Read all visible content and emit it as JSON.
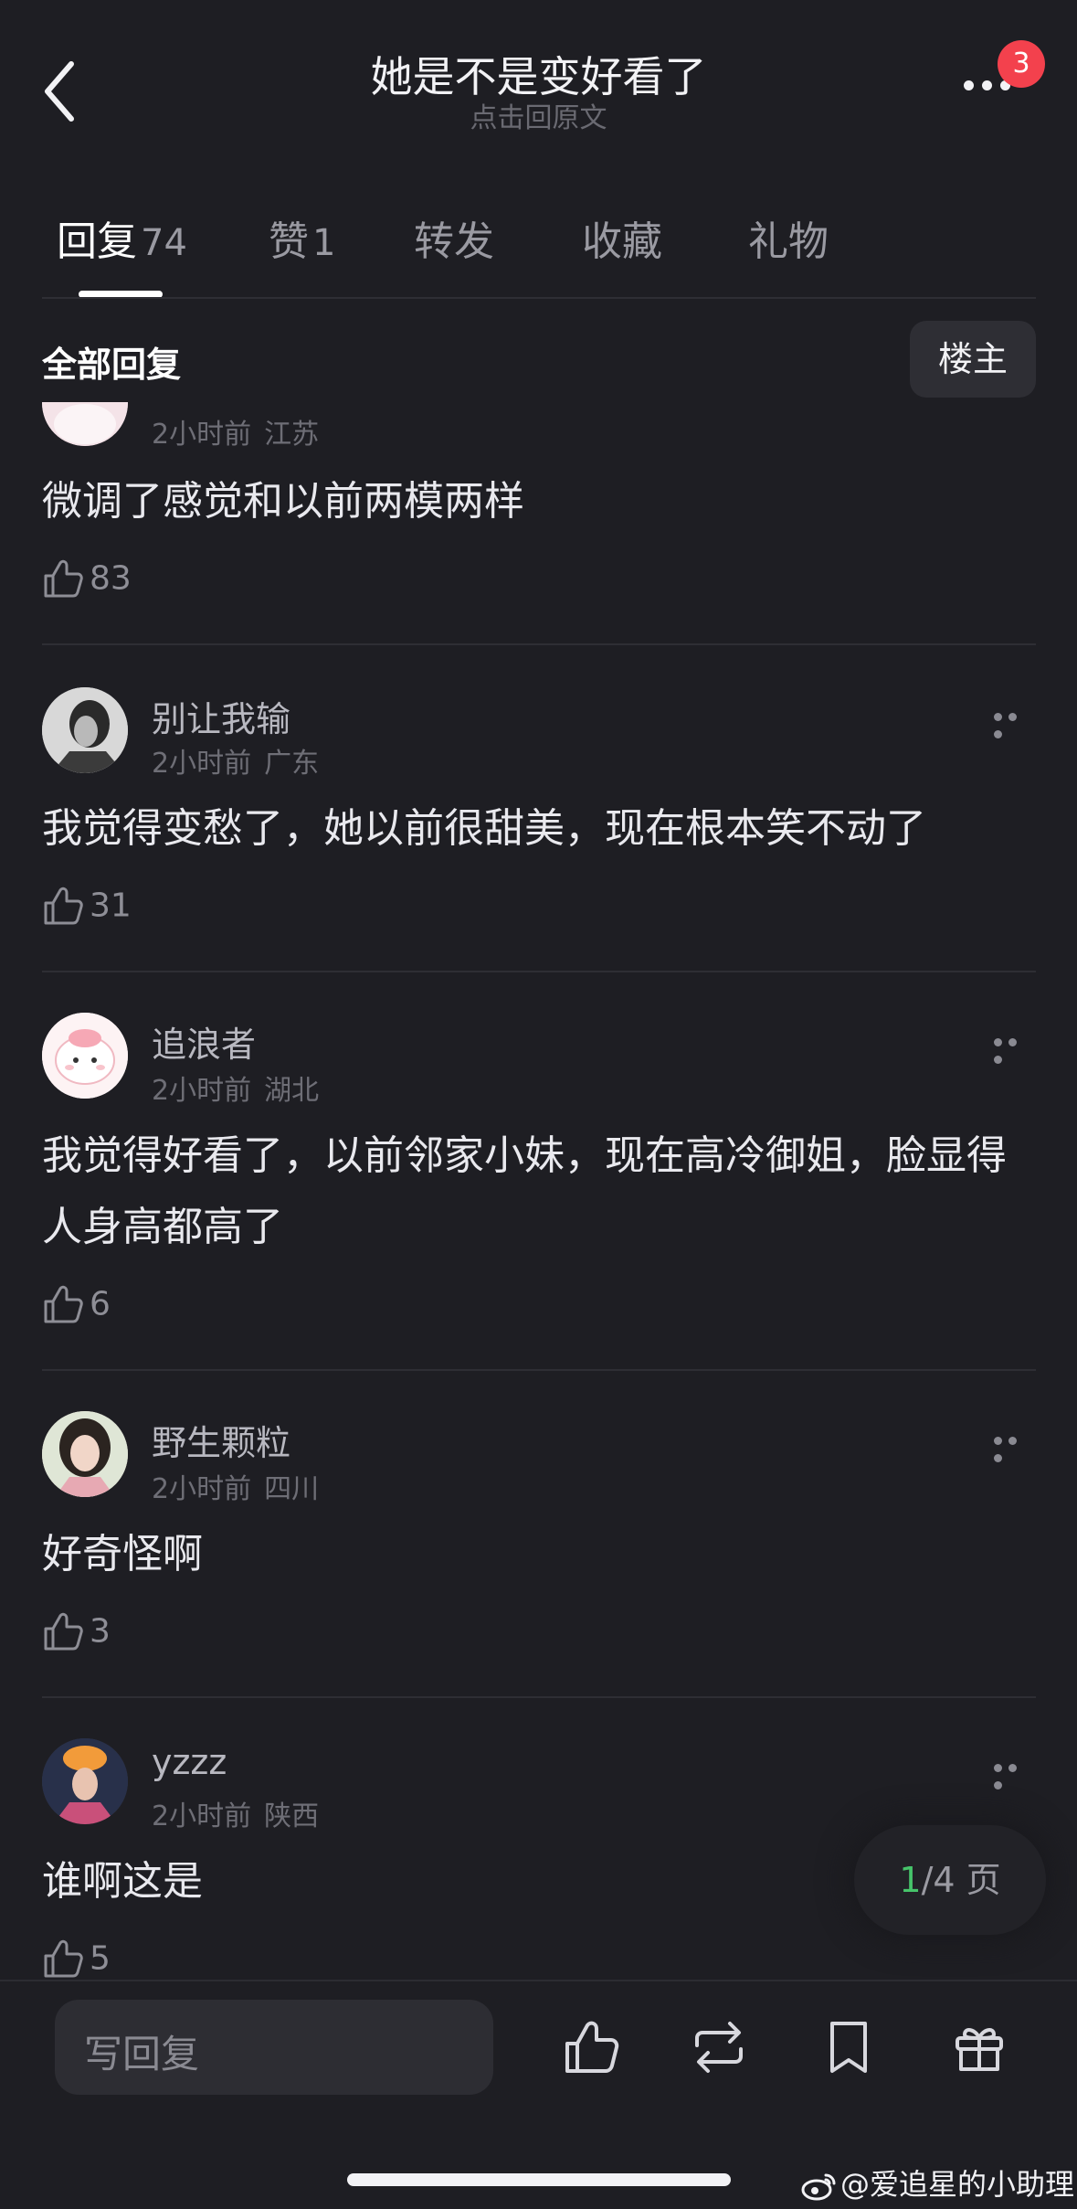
{
  "header": {
    "title": "她是不是变好看了",
    "subtitle": "点击回原文",
    "badge_count": "3"
  },
  "tabs": [
    {
      "label": "回复",
      "count": "74"
    },
    {
      "label": "赞",
      "count": "1"
    },
    {
      "label": "转发",
      "count": ""
    },
    {
      "label": "收藏",
      "count": ""
    },
    {
      "label": "礼物",
      "count": ""
    }
  ],
  "section": {
    "title": "全部回复",
    "op_filter_label": "楼主"
  },
  "comments": [
    {
      "username": "",
      "time": "2小时前",
      "location": "江苏",
      "text": "微调了感觉和以前两模两样",
      "likes": "83"
    },
    {
      "username": "别让我输",
      "time": "2小时前",
      "location": "广东",
      "text": "我觉得变愁了，她以前很甜美，现在根本笑不动了",
      "likes": "31"
    },
    {
      "username": "追浪者",
      "time": "2小时前",
      "location": "湖北",
      "text": "我觉得好看了，以前邻家小妹，现在高冷御姐，脸显得人身高都高了",
      "likes": "6"
    },
    {
      "username": "野生颗粒",
      "time": "2小时前",
      "location": "四川",
      "text": "好奇怪啊",
      "likes": "3"
    },
    {
      "username": "yzzz",
      "time": "2小时前",
      "location": "陕西",
      "text": "谁啊这是",
      "likes": "5"
    }
  ],
  "pager": {
    "current": "1",
    "total_text": "/4 页"
  },
  "bottom_bar": {
    "reply_placeholder": "写回复",
    "icons": [
      "like-icon",
      "repost-icon",
      "bookmark-icon",
      "gift-icon"
    ]
  },
  "watermark": "@爱追星的小助理",
  "colors": {
    "background": "#1e1e23",
    "badge": "#f3414d",
    "pager_current": "#46c46a"
  }
}
